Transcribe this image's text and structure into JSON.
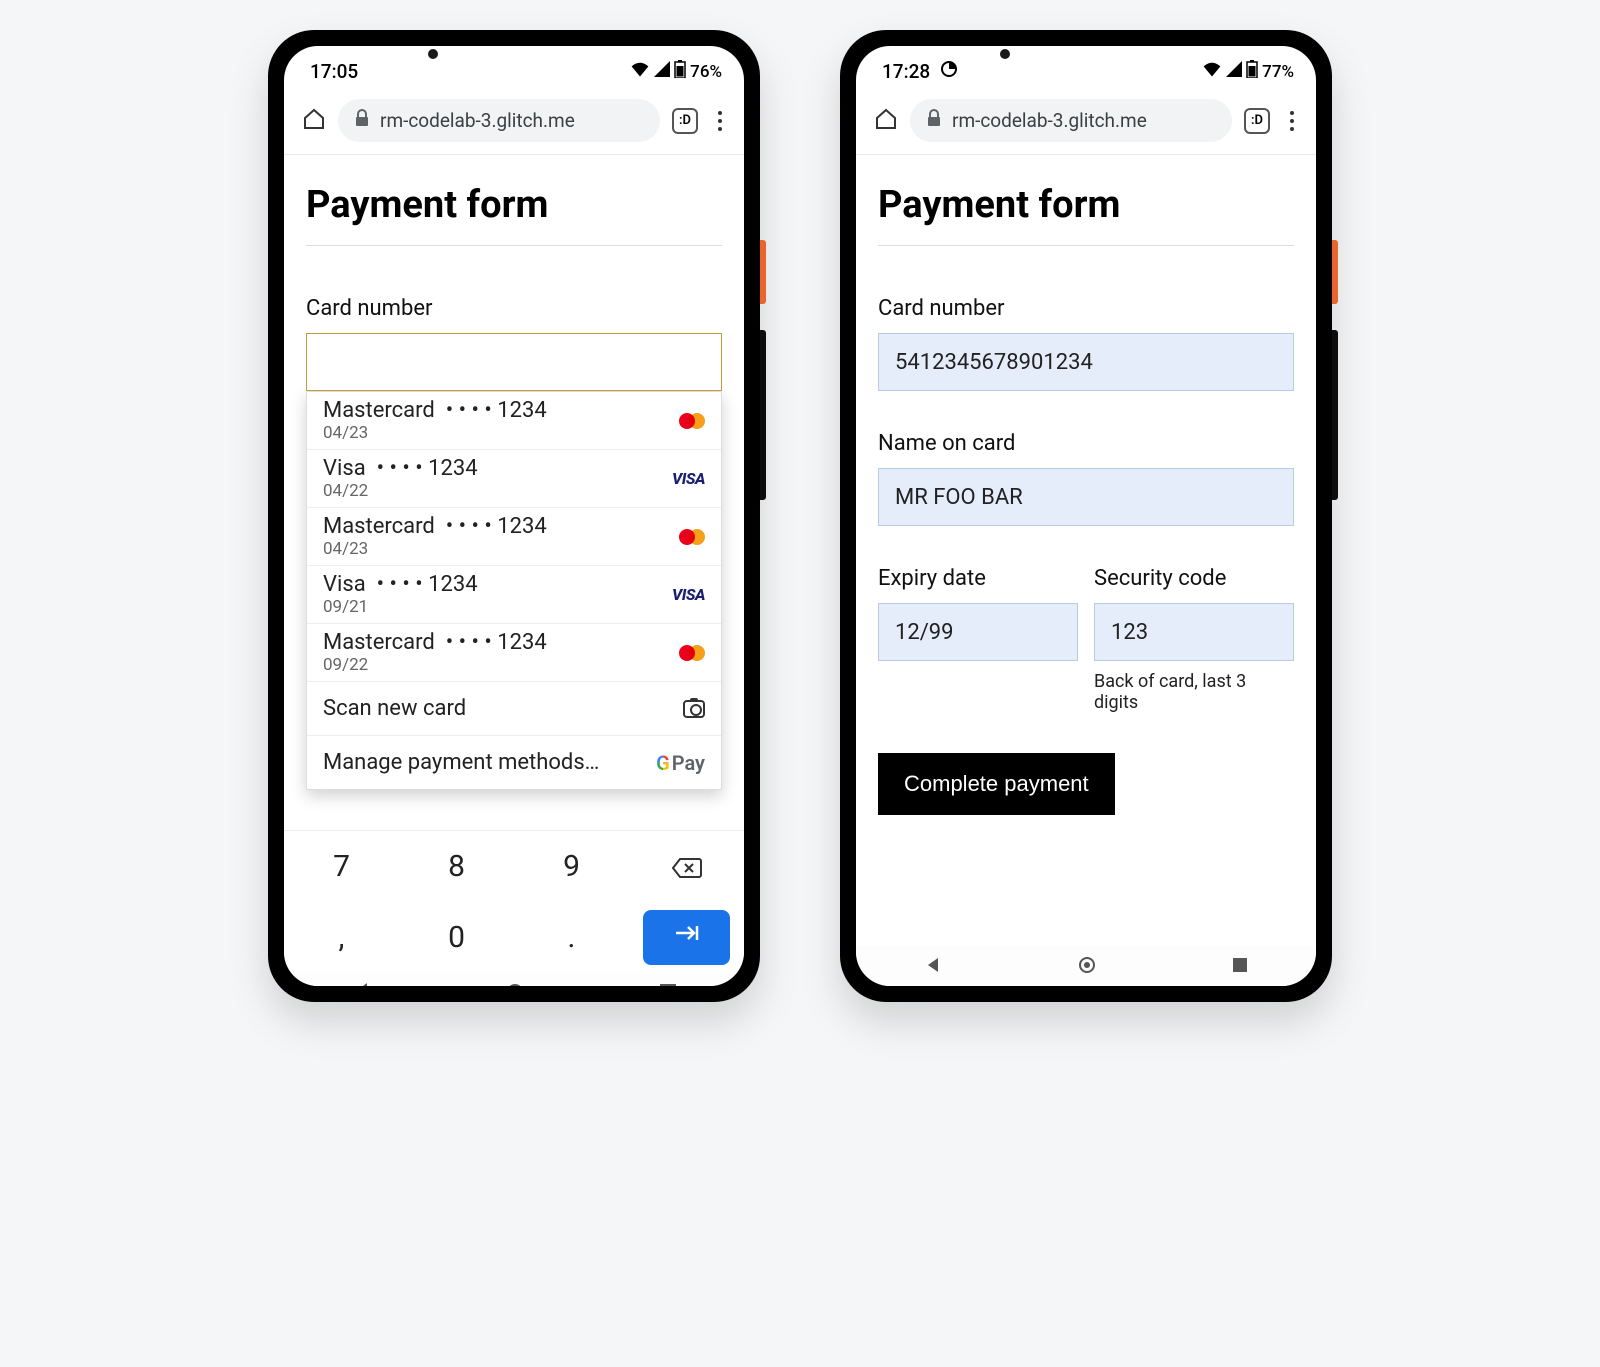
{
  "phone1": {
    "time": "17:05",
    "battery": "76%",
    "url": "rm-codelab-3.glitch.me",
    "tab_count": ":D",
    "title": "Payment form",
    "card_number_label": "Card number",
    "autofill": [
      {
        "brand": "Mastercard",
        "mask": "• • • • 1234",
        "exp": "04/23",
        "type": "mc"
      },
      {
        "brand": "Visa",
        "mask": "• • • • 1234",
        "exp": "04/22",
        "type": "visa"
      },
      {
        "brand": "Mastercard",
        "mask": "• • • • 1234",
        "exp": "04/23",
        "type": "mc"
      },
      {
        "brand": "Visa",
        "mask": "• • • • 1234",
        "exp": "09/21",
        "type": "visa"
      },
      {
        "brand": "Mastercard",
        "mask": "• • • • 1234",
        "exp": "09/22",
        "type": "mc"
      }
    ],
    "scan_label": "Scan new card",
    "manage_label": "Manage payment methods…",
    "gpay_label": "Pay",
    "keys": [
      "7",
      "8",
      "9",
      "⌫",
      ",",
      "0",
      ".",
      "→|"
    ]
  },
  "phone2": {
    "time": "17:28",
    "battery": "77%",
    "url": "rm-codelab-3.glitch.me",
    "tab_count": ":D",
    "title": "Payment form",
    "card_number_label": "Card number",
    "card_number_value": "5412345678901234",
    "name_label": "Name on card",
    "name_value": "MR FOO BAR",
    "expiry_label": "Expiry date",
    "expiry_value": "12/99",
    "cvc_label": "Security code",
    "cvc_value": "123",
    "cvc_help": "Back of card, last 3 digits",
    "submit_label": "Complete payment"
  }
}
